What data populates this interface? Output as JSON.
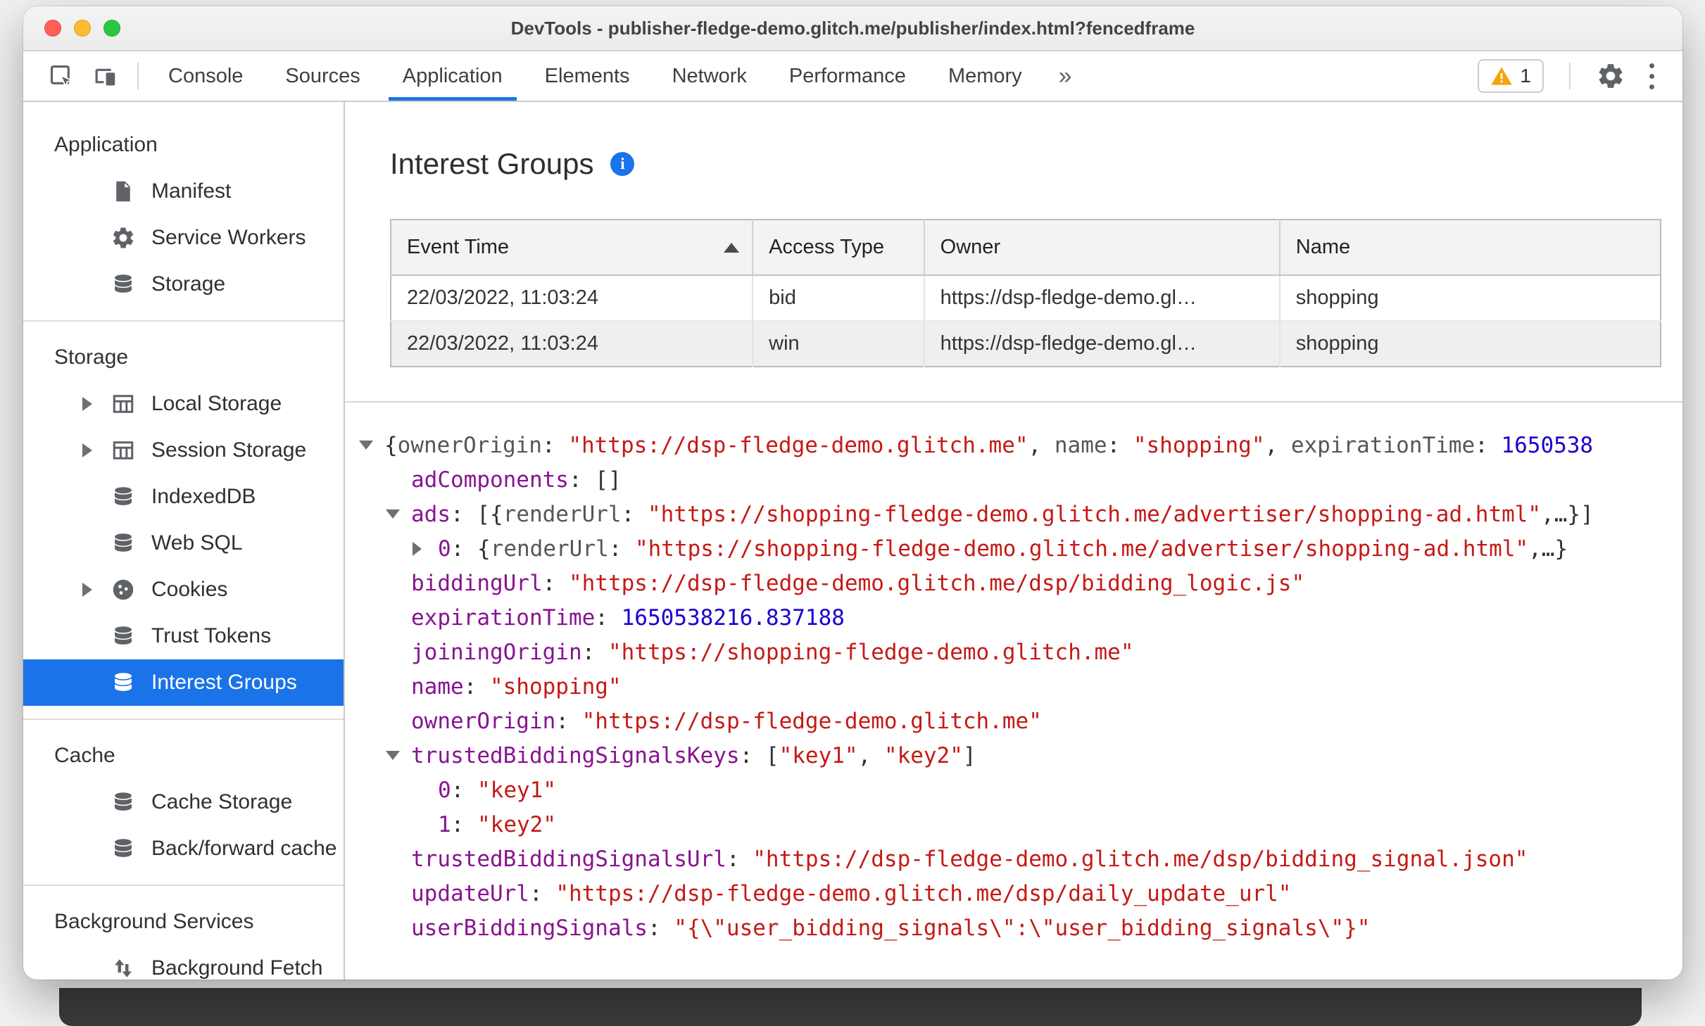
{
  "colors": {
    "accent_blue": "#1a73e8",
    "selection_bg": "#1a73e8",
    "key_purple": "#881391",
    "string_red": "#c41a16",
    "number_blue": "#1c00cf",
    "warning_yellow": "#f5a30b"
  },
  "window": {
    "title": "DevTools - publisher-fledge-demo.glitch.me/publisher/index.html?fencedframe"
  },
  "toolbar": {
    "tabs": [
      {
        "label": "Console",
        "active": false
      },
      {
        "label": "Sources",
        "active": false
      },
      {
        "label": "Application",
        "active": true
      },
      {
        "label": "Elements",
        "active": false
      },
      {
        "label": "Network",
        "active": false
      },
      {
        "label": "Performance",
        "active": false
      },
      {
        "label": "Memory",
        "active": false
      }
    ],
    "more_label": "»",
    "warning_count": "1"
  },
  "sidebar": {
    "sections": [
      {
        "header": "Application",
        "items": [
          {
            "label": "Manifest",
            "icon": "document-icon"
          },
          {
            "label": "Service Workers",
            "icon": "gear-icon"
          },
          {
            "label": "Storage",
            "icon": "database-icon"
          }
        ]
      },
      {
        "header": "Storage",
        "items": [
          {
            "label": "Local Storage",
            "icon": "table-icon",
            "expandable": true
          },
          {
            "label": "Session Storage",
            "icon": "table-icon",
            "expandable": true
          },
          {
            "label": "IndexedDB",
            "icon": "database-icon"
          },
          {
            "label": "Web SQL",
            "icon": "database-icon"
          },
          {
            "label": "Cookies",
            "icon": "cookie-icon",
            "expandable": true
          },
          {
            "label": "Trust Tokens",
            "icon": "database-icon"
          },
          {
            "label": "Interest Groups",
            "icon": "database-icon",
            "selected": true
          }
        ]
      },
      {
        "header": "Cache",
        "items": [
          {
            "label": "Cache Storage",
            "icon": "database-icon"
          },
          {
            "label": "Back/forward cache",
            "icon": "database-icon"
          }
        ]
      },
      {
        "header": "Background Services",
        "items": [
          {
            "label": "Background Fetch",
            "icon": "fetch-icon"
          }
        ]
      }
    ]
  },
  "main": {
    "title": "Interest Groups",
    "table": {
      "headers": [
        "Event Time",
        "Access Type",
        "Owner",
        "Name"
      ],
      "sorted_column": 0,
      "sort_direction": "asc",
      "rows": [
        [
          "22/03/2022, 11:03:24",
          "bid",
          "https://dsp-fledge-demo.gl…",
          "shopping"
        ],
        [
          "22/03/2022, 11:03:24",
          "win",
          "https://dsp-fledge-demo.gl…",
          "shopping"
        ]
      ]
    },
    "tree": {
      "lines": [
        {
          "indent": 0,
          "arrow": "down",
          "segments": [
            [
              "plain",
              "{"
            ],
            [
              "prekey",
              "ownerOrigin"
            ],
            [
              "plain",
              ": "
            ],
            [
              "str",
              "\"https://dsp-fledge-demo.glitch.me\""
            ],
            [
              "plain",
              ", "
            ],
            [
              "prekey",
              "name"
            ],
            [
              "plain",
              ": "
            ],
            [
              "str",
              "\"shopping\""
            ],
            [
              "plain",
              ", "
            ],
            [
              "prekey",
              "expirationTime"
            ],
            [
              "plain",
              ": "
            ],
            [
              "num",
              "1650538"
            ]
          ]
        },
        {
          "indent": 1,
          "arrow": null,
          "segments": [
            [
              "key",
              "adComponents"
            ],
            [
              "plain",
              ": "
            ],
            [
              "plain",
              "[]"
            ]
          ]
        },
        {
          "indent": 1,
          "arrow": "down",
          "segments": [
            [
              "key",
              "ads"
            ],
            [
              "plain",
              ": "
            ],
            [
              "plain",
              "[{"
            ],
            [
              "prekey",
              "renderUrl"
            ],
            [
              "plain",
              ": "
            ],
            [
              "str",
              "\"https://shopping-fledge-demo.glitch.me/advertiser/shopping-ad.html\""
            ],
            [
              "plain",
              ",…}]"
            ]
          ]
        },
        {
          "indent": 2,
          "arrow": "right",
          "segments": [
            [
              "key",
              "0"
            ],
            [
              "plain",
              ": {"
            ],
            [
              "prekey",
              "renderUrl"
            ],
            [
              "plain",
              ": "
            ],
            [
              "str",
              "\"https://shopping-fledge-demo.glitch.me/advertiser/shopping-ad.html\""
            ],
            [
              "plain",
              ",…}"
            ]
          ]
        },
        {
          "indent": 1,
          "arrow": null,
          "segments": [
            [
              "key",
              "biddingUrl"
            ],
            [
              "plain",
              ": "
            ],
            [
              "str",
              "\"https://dsp-fledge-demo.glitch.me/dsp/bidding_logic.js\""
            ]
          ]
        },
        {
          "indent": 1,
          "arrow": null,
          "segments": [
            [
              "key",
              "expirationTime"
            ],
            [
              "plain",
              ": "
            ],
            [
              "num",
              "1650538216.837188"
            ]
          ]
        },
        {
          "indent": 1,
          "arrow": null,
          "segments": [
            [
              "key",
              "joiningOrigin"
            ],
            [
              "plain",
              ": "
            ],
            [
              "str",
              "\"https://shopping-fledge-demo.glitch.me\""
            ]
          ]
        },
        {
          "indent": 1,
          "arrow": null,
          "segments": [
            [
              "key",
              "name"
            ],
            [
              "plain",
              ": "
            ],
            [
              "str",
              "\"shopping\""
            ]
          ]
        },
        {
          "indent": 1,
          "arrow": null,
          "segments": [
            [
              "key",
              "ownerOrigin"
            ],
            [
              "plain",
              ": "
            ],
            [
              "str",
              "\"https://dsp-fledge-demo.glitch.me\""
            ]
          ]
        },
        {
          "indent": 1,
          "arrow": "down",
          "segments": [
            [
              "key",
              "trustedBiddingSignalsKeys"
            ],
            [
              "plain",
              ": "
            ],
            [
              "plain",
              "["
            ],
            [
              "str",
              "\"key1\""
            ],
            [
              "plain",
              ", "
            ],
            [
              "str",
              "\"key2\""
            ],
            [
              "plain",
              "]"
            ]
          ]
        },
        {
          "indent": 2,
          "arrow": null,
          "segments": [
            [
              "key",
              "0"
            ],
            [
              "plain",
              ": "
            ],
            [
              "str",
              "\"key1\""
            ]
          ]
        },
        {
          "indent": 2,
          "arrow": null,
          "segments": [
            [
              "key",
              "1"
            ],
            [
              "plain",
              ": "
            ],
            [
              "str",
              "\"key2\""
            ]
          ]
        },
        {
          "indent": 1,
          "arrow": null,
          "segments": [
            [
              "key",
              "trustedBiddingSignalsUrl"
            ],
            [
              "plain",
              ": "
            ],
            [
              "str",
              "\"https://dsp-fledge-demo.glitch.me/dsp/bidding_signal.json\""
            ]
          ]
        },
        {
          "indent": 1,
          "arrow": null,
          "segments": [
            [
              "key",
              "updateUrl"
            ],
            [
              "plain",
              ": "
            ],
            [
              "str",
              "\"https://dsp-fledge-demo.glitch.me/dsp/daily_update_url\""
            ]
          ]
        },
        {
          "indent": 1,
          "arrow": null,
          "segments": [
            [
              "key",
              "userBiddingSignals"
            ],
            [
              "plain",
              ": "
            ],
            [
              "str",
              "\"{\\\"user_bidding_signals\\\":\\\"user_bidding_signals\\\"}\""
            ]
          ]
        }
      ]
    }
  }
}
